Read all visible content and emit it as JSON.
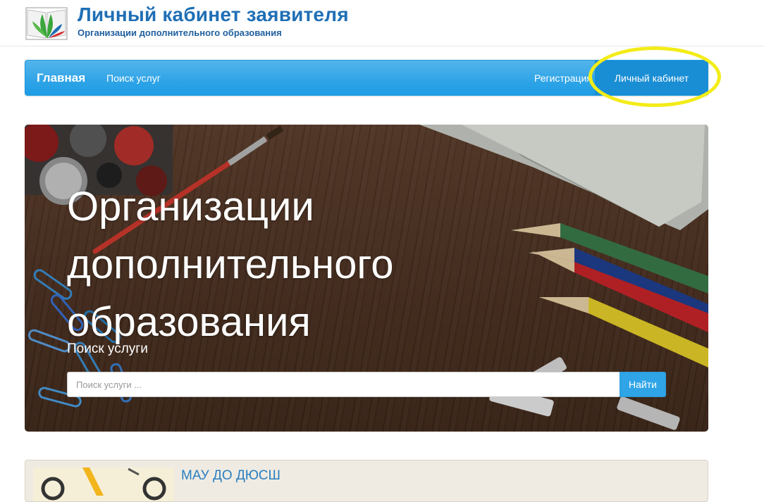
{
  "header": {
    "title": "Личный кабинет заявителя",
    "subtitle": "Организации дополнительного образования",
    "logo_icon": "union-logo-icon"
  },
  "navbar": {
    "brand": "Главная",
    "search_services": "Поиск услуг",
    "register": "Регистрация",
    "cabinet": "Личный кабинет"
  },
  "hero": {
    "title_line1": "Организации",
    "title_line2": "дополнительного",
    "title_line3": "образования",
    "search_label": "Поиск услуги",
    "search_placeholder": "Поиск услуги ...",
    "search_button": "Найти"
  },
  "org_card": {
    "name": "МАУ ДО ДЮСШ"
  },
  "colors": {
    "brand_blue": "#2fa4e7",
    "title_blue": "#1f6fb5",
    "highlight": "#f3ec18"
  }
}
